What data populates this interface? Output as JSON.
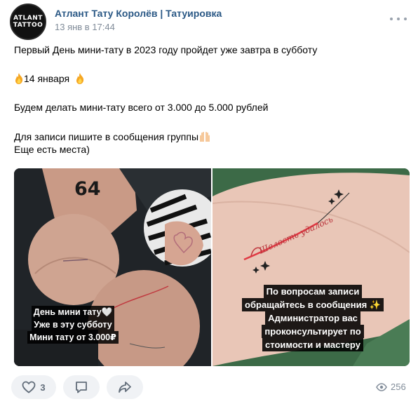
{
  "group": {
    "avatar_line1": "ATLANT",
    "avatar_line2": "TATTOO",
    "name": "Атлант Тату Королёв | Татуировка",
    "time": "13 янв в 17:44"
  },
  "post": {
    "line1": "Первый День мини-тату в 2023 году пройдет уже завтра в субботу",
    "date": "14 января",
    "line3": "Будем делать мини-тату всего от 3.000 до 5.000 рублей",
    "line4": "Для записи пишите в сообщения группы",
    "line5": "Еще есть места)"
  },
  "images": {
    "left": {
      "number_tattoo": "64",
      "caption": [
        "День мини тату🤍",
        "Уже в эту субботу",
        "Мини тату от 3.000₽"
      ]
    },
    "right": {
      "script_tattoo": "Шелость удалось",
      "caption": [
        "По вопросам записи",
        "обращайтесь в сообщения ✨",
        "Администратор вас",
        "проконсультирует по",
        "стоимости и мастеру"
      ]
    }
  },
  "footer": {
    "likes": "3",
    "views": "256",
    "icons": [
      "heart-icon",
      "comment-icon",
      "share-icon",
      "eye-icon"
    ]
  }
}
